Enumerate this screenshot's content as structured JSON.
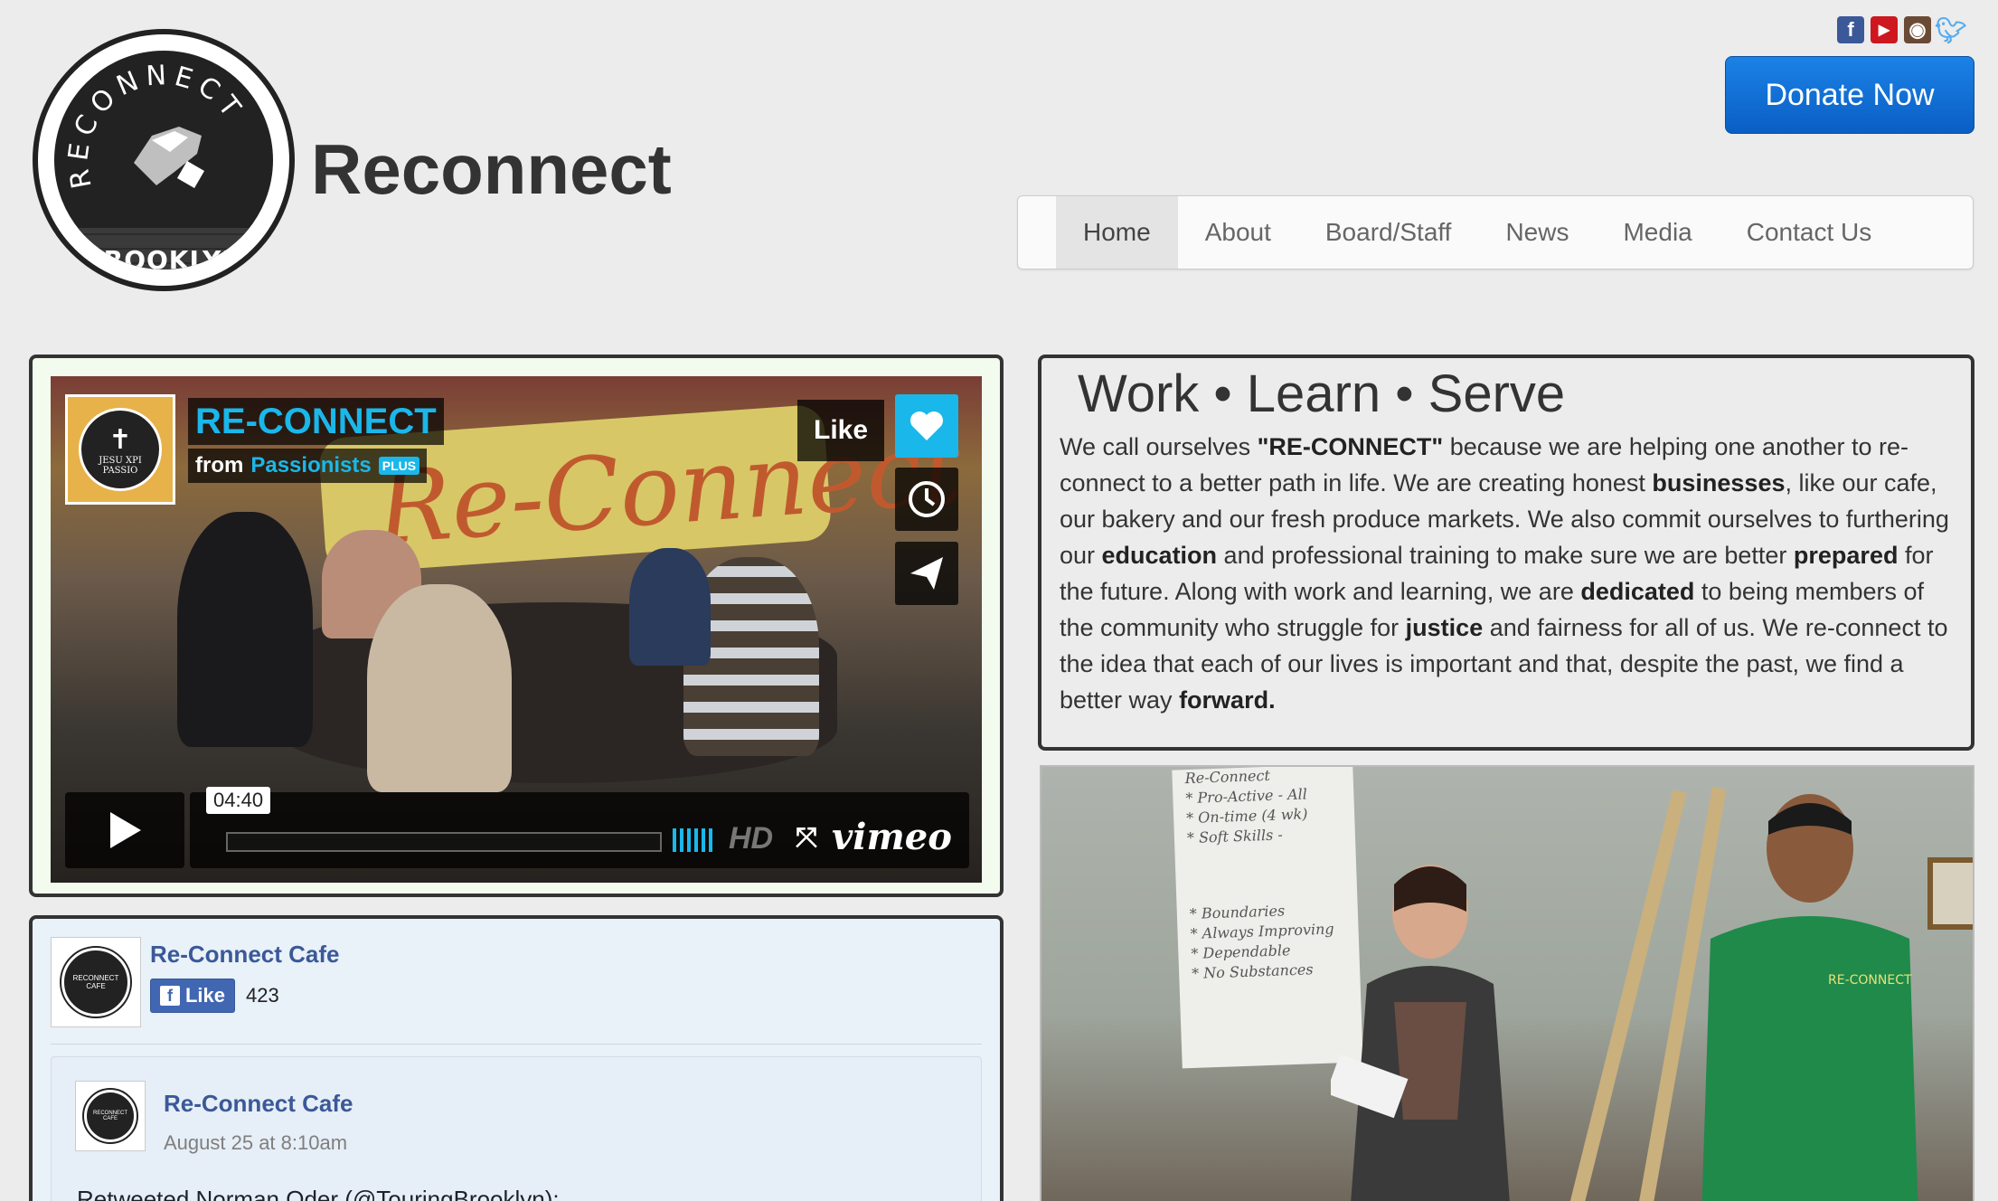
{
  "header": {
    "logo": {
      "arc_text": "RECONNECT",
      "city": "BROOKLYN"
    },
    "site_title": "Reconnect",
    "donate_label": "Donate Now",
    "social": [
      "facebook-icon",
      "youtube-icon",
      "instagram-icon",
      "twitter-icon"
    ]
  },
  "nav": {
    "items": [
      {
        "label": "Home",
        "active": true
      },
      {
        "label": "About",
        "active": false
      },
      {
        "label": "Board/Staff",
        "active": false
      },
      {
        "label": "News",
        "active": false
      },
      {
        "label": "Media",
        "active": false
      },
      {
        "label": "Contact Us",
        "active": false
      }
    ]
  },
  "video": {
    "title": "RE-CONNECT",
    "from_prefix": "from",
    "owner": "Passionists",
    "owner_badge": "PLUS",
    "badge_text": "JESU XPI PASSIO",
    "like_label": "Like",
    "time": "04:40",
    "hd_label": "HD",
    "brand": "vimeo",
    "banner_text": "Re-Connect"
  },
  "facebook": {
    "page_name": "Re-Connect Cafe",
    "like_label": "Like",
    "like_count": "423",
    "avatar_text": "RECONNECT CAFE",
    "post": {
      "author": "Re-Connect Cafe",
      "date": "August 25 at 8:10am",
      "text": "Retweeted Norman Oder (@TouringBrooklyn):"
    }
  },
  "about": {
    "heading": "Work • Learn • Serve",
    "segments": [
      {
        "t": "We call ourselves ",
        "b": false
      },
      {
        "t": "\"RE-CONNECT\"",
        "b": true
      },
      {
        "t": " because we are helping one another to re-connect to a better path in life. We are creating honest ",
        "b": false
      },
      {
        "t": "businesses",
        "b": true
      },
      {
        "t": ", like our cafe, our bakery and our fresh produce markets. We also commit ourselves to furthering our ",
        "b": false
      },
      {
        "t": "education",
        "b": true
      },
      {
        "t": " and professional training to make sure we are better ",
        "b": false
      },
      {
        "t": "prepared",
        "b": true
      },
      {
        "t": " for the future. Along with work and learning, we are ",
        "b": false
      },
      {
        "t": "dedicated",
        "b": true
      },
      {
        "t": " to being members of the community who struggle for ",
        "b": false
      },
      {
        "t": "justice",
        "b": true
      },
      {
        "t": " and fairness for all of us. We re-connect to the idea that each of our lives is important and that, despite the past, we find a better way ",
        "b": false
      },
      {
        "t": "forward.",
        "b": true
      }
    ]
  },
  "photo": {
    "whiteboard_lines": [
      "Re-Connect",
      "* Pro-Active - All",
      "* On-time (4 wk)",
      "* Soft Skills -",
      "* Boundaries",
      "* Always Improving",
      "* Dependable",
      "* No Substances"
    ],
    "shirt_text": "RE-CONNECT"
  },
  "colors": {
    "accent_blue": "#1ab7ea",
    "donate_blue": "#0a5ec4",
    "facebook_blue": "#3b5998"
  }
}
